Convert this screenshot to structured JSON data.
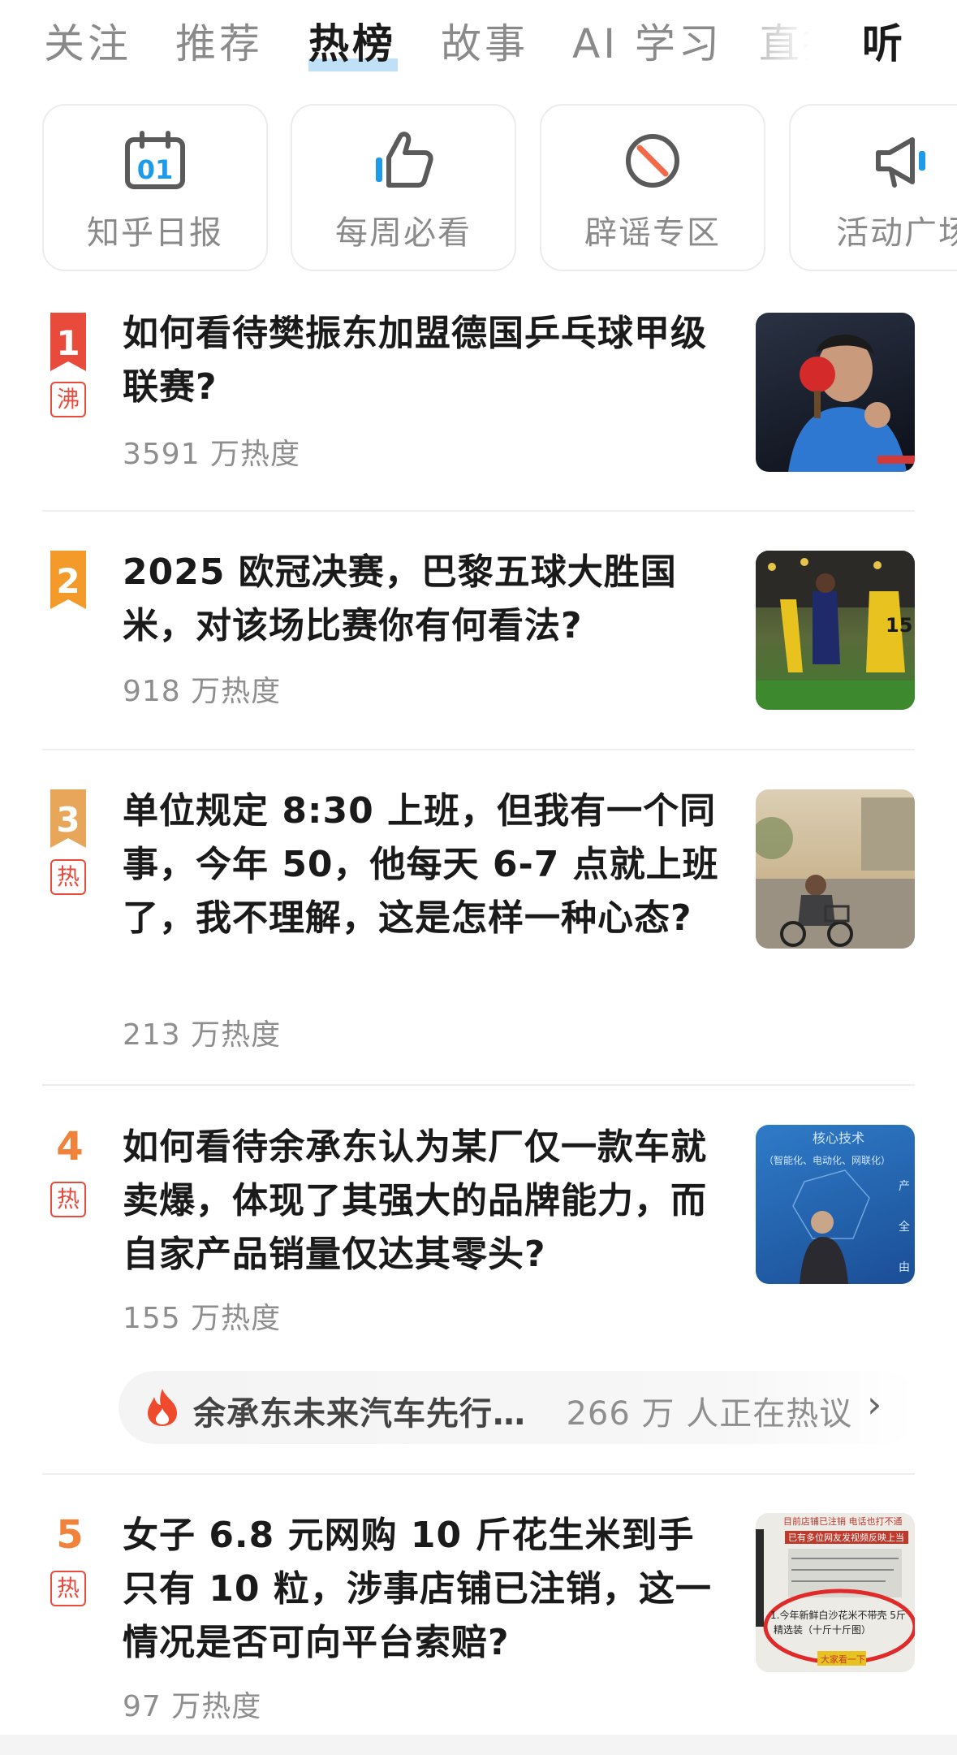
{
  "tabs": [
    {
      "label": "关注"
    },
    {
      "label": "推荐"
    },
    {
      "label": "热榜"
    },
    {
      "label": "故事"
    },
    {
      "label": "AI 学习"
    },
    {
      "label": "直播"
    },
    {
      "label": "听"
    }
  ],
  "shortcuts": [
    {
      "label": "知乎日报",
      "icon": "calendar-01-icon",
      "icon_text": "01"
    },
    {
      "label": "每周必看",
      "icon": "thumbs-up-icon"
    },
    {
      "label": "辟谣专区",
      "icon": "no-sign-icon"
    },
    {
      "label": "活动广场",
      "icon": "megaphone-icon"
    }
  ],
  "hot_list": [
    {
      "rank": "1",
      "tag": "沸",
      "title": "如何看待樊振东加盟德国乒乓球甲级联赛?",
      "heat": "3591 万热度"
    },
    {
      "rank": "2",
      "tag": "",
      "title": "2025 欧冠决赛，巴黎五球大胜国米，对该场比赛你有何看法?",
      "heat": "918 万热度"
    },
    {
      "rank": "3",
      "tag": "热",
      "title": "单位规定 8:30 上班，但我有一个同事，今年 50，他每天 6-7 点就上班了，我不理解，这是怎样一种心态?",
      "heat": "213 万热度"
    },
    {
      "rank": "4",
      "tag": "热",
      "title": "如何看待余承东认为某厂仅一款车就卖爆，体现了其强大的品牌能力，而自家产品销量仅达其零头?",
      "heat": "155 万热度"
    },
    {
      "rank": "5",
      "tag": "热",
      "title": "女子 6.8 元网购 10 斤花生米到手只有 10 粒，涉事店铺已注销，这一情况是否可向平台索赔?",
      "heat": "97 万热度"
    }
  ],
  "sub_topic": {
    "text": "余承东未来汽车先行…",
    "count": "266 万 人正在热议",
    "icon": "flame-icon",
    "arrow": "›"
  },
  "thumb_texts": {
    "item4": {
      "heading": "核心技术",
      "sub": "（智能化、电动化、网联化）",
      "side1": "产",
      "side2": "全",
      "side3": "由"
    },
    "item5": {
      "line1": "目前店铺已注销 电话也打不通",
      "line2": "已有多位网友发视频反映上当",
      "line3": "1.今年新鲜白沙花米不带壳 5斤",
      "line4": "精选装（十斤十斤图）",
      "line5": "大家看一下"
    }
  },
  "colors": {
    "accent": "#1a1a1a",
    "rank1": "#e84a3c",
    "rank2": "#f39a2a",
    "rank3": "#e8a65a",
    "tag": "#e84a3c",
    "muted": "#8e8e8e"
  }
}
